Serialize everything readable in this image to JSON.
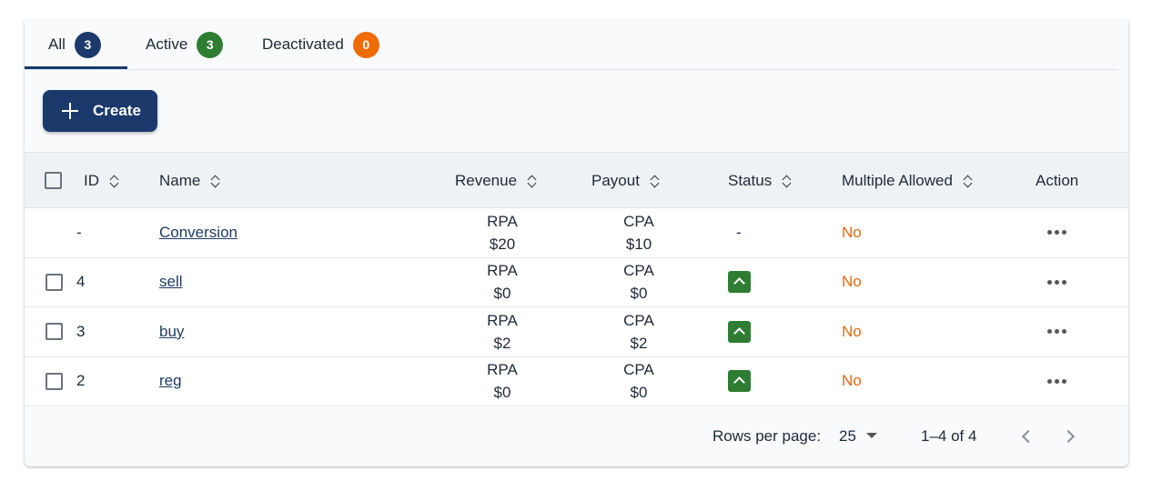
{
  "tabs": [
    {
      "label": "All",
      "count": "3",
      "color": "#1b3a6b"
    },
    {
      "label": "Active",
      "count": "3",
      "color": "#2e7d32"
    },
    {
      "label": "Deactivated",
      "count": "0",
      "color": "#ef6c00"
    }
  ],
  "create_button": {
    "label": "Create"
  },
  "table": {
    "headers": [
      "ID",
      "Name",
      "Revenue",
      "Payout",
      "Status",
      "Multiple Allowed",
      "Action"
    ],
    "rows": [
      {
        "id": "-",
        "name": "Conversion",
        "revenue_type": "RPA",
        "revenue": "$20",
        "payout_type": "CPA",
        "payout": "$10",
        "status": "-",
        "multiple_allowed": "No"
      },
      {
        "id": "4",
        "name": "sell",
        "revenue_type": "RPA",
        "revenue": "$0",
        "payout_type": "CPA",
        "payout": "$0",
        "status": "active-icon",
        "multiple_allowed": "No"
      },
      {
        "id": "3",
        "name": "buy",
        "revenue_type": "RPA",
        "revenue": "$2",
        "payout_type": "CPA",
        "payout": "$2",
        "status": "active-icon",
        "multiple_allowed": "No"
      },
      {
        "id": "2",
        "name": "reg",
        "revenue_type": "RPA",
        "revenue": "$0",
        "payout_type": "CPA",
        "payout": "$0",
        "status": "active-icon",
        "multiple_allowed": "No"
      }
    ]
  },
  "pagination": {
    "rows_per_page_label": "Rows per page:",
    "rows_per_page_value": "25",
    "range": "1–4 of 4"
  },
  "colors": {
    "primary": "#1b3a6b",
    "success": "#2e7d32",
    "warning": "#ef6c00",
    "link": "#1f3b63"
  }
}
